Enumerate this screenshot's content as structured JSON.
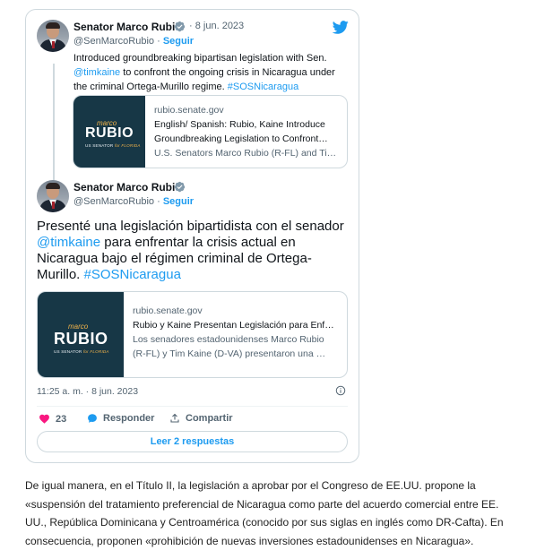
{
  "tweet1": {
    "author_name": "Senator Marco Rubio",
    "date": "8 jun. 2023",
    "handle": "@SenMarcoRubio",
    "separator": "·",
    "follow_label": "Seguir",
    "text_line1": "Introduced groundbreaking bipartisan legislation with Sen.",
    "mention": "@timkaine",
    "text_line2": " to confront the ongoing crisis in Nicaragua under",
    "text_line3": "the criminal Ortega-Murillo regime. ",
    "hashtag": "#SOSNicaragua",
    "link_card": {
      "domain": "rubio.senate.gov",
      "title_line1": "English/ Spanish: Rubio, Kaine Introduce",
      "title_line2": "Groundbreaking Legislation to Confront…",
      "description": "U.S. Senators Marco Rubio (R-FL) and Ti…",
      "thumb_script": "marco",
      "thumb_name": "RUBIO",
      "thumb_sub": "US SENATOR",
      "thumb_sub_for": "for",
      "thumb_sub_state": "FLORIDA"
    }
  },
  "tweet2": {
    "author_name": "Senator Marco Rubio",
    "handle": "@SenMarcoRubio",
    "separator": "·",
    "follow_label": "Seguir",
    "text_line1": "Presenté una legislación bipartidista con el senador",
    "mention": "@timkaine",
    "text_line2": " para enfrentar la crisis actual en",
    "text_line3": "Nicaragua bajo el régimen criminal de Ortega-",
    "text_line4": "Murillo. ",
    "hashtag": "#SOSNicaragua",
    "link_card": {
      "domain": "rubio.senate.gov",
      "title": "Rubio y Kaine Presentan Legislación para Enf…",
      "desc_line1": "Los senadores estadounidenses Marco Rubio",
      "desc_line2": "(R-FL) y Tim Kaine (D-VA) presentaron una …",
      "thumb_script": "marco",
      "thumb_name": "RUBIO",
      "thumb_sub": "US SENATOR",
      "thumb_sub_for": "for",
      "thumb_sub_state": "FLORIDA"
    },
    "timestamp": "11:25 a. m. · 8 jun. 2023",
    "like_count": "23",
    "reply_label": "Responder",
    "share_label": "Compartir",
    "read_replies_label": "Leer 2 respuestas"
  },
  "article": {
    "paragraph": "De igual manera, en el Título II, la legislación a aprobar por el Congreso de EE.UU. propone la «suspensión del tratamiento preferencial de Nicaragua como parte del acuerdo comercial entre EE. UU., República Dominicana y Centroamérica (conocido por sus siglas en inglés como DR-Cafta). En consecuencia, proponen «prohibición de nuevas inversiones estadounidenses en Nicaragua»."
  },
  "colors": {
    "twitter_blue": "#1d9bf0",
    "like_pink": "#f91880",
    "thumb_navy": "#173746",
    "thumb_gold": "#f0b24a"
  }
}
